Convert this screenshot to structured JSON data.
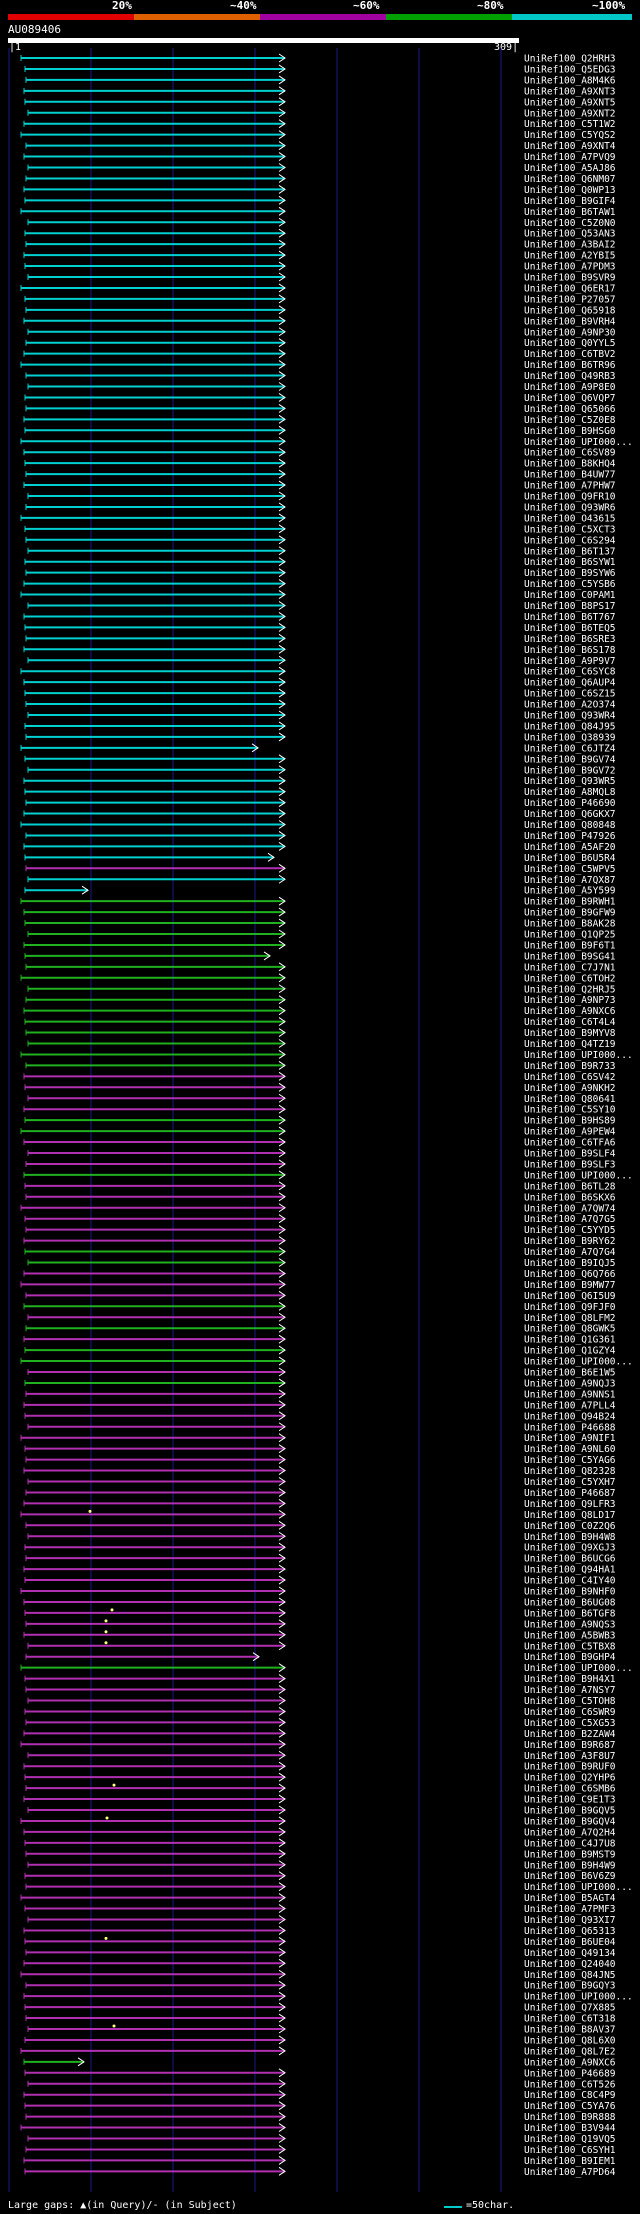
{
  "legend": {
    "labels": [
      "20%",
      "~40%",
      "~60%",
      "~80%",
      "~100%"
    ],
    "colors": [
      "#e00000",
      "#e06000",
      "#a000a0",
      "#00a000",
      "#00c8c8"
    ]
  },
  "query": {
    "id": "AU089406",
    "start": "1",
    "end": "309"
  },
  "colors": {
    "cyan": "#00d0d0",
    "green": "#20b020",
    "magenta": "#b030b0",
    "arrow_line": "#ffffff",
    "gap_marker": "#ffff80",
    "grid": "#1a1a8a"
  },
  "hits": [
    "UniRef100_Q2HRH3",
    "UniRef100_Q5EDG3",
    "UniRef100_A8M4K6",
    "UniRef100_A9XNT3",
    "UniRef100_A9XNT5",
    "UniRef100_A9XNT2",
    "UniRef100_C5T1W2",
    "UniRef100_C5YQS2",
    "UniRef100_A9XNT4",
    "UniRef100_A7PVQ9",
    "UniRef100_A5AJ86",
    "UniRef100_Q6NM07",
    "UniRef100_Q0WP13",
    "UniRef100_B9GIF4",
    "UniRef100_B6TAW1",
    "UniRef100_C5Z0N0",
    "UniRef100_Q53AN3",
    "UniRef100_A3BAI2",
    "UniRef100_A2YBI5",
    "UniRef100_A7PDM3",
    "UniRef100_B9SVR9",
    "UniRef100_Q6ER17",
    "UniRef100_P27057",
    "UniRef100_Q65918",
    "UniRef100_B9VRH4",
    "UniRef100_A9NP30",
    "UniRef100_Q0YYL5",
    "UniRef100_C6TBV2",
    "UniRef100_B6TR96",
    "UniRef100_Q49RB3",
    "UniRef100_A9P8E0",
    "UniRef100_Q6VQP7",
    "UniRef100_Q65066",
    "UniRef100_C5Z0E8",
    "UniRef100_B9HSG0",
    "UniRef100_UPI000...",
    "UniRef100_C6SV89",
    "UniRef100_B8KHQ4",
    "UniRef100_B4UW77",
    "UniRef100_A7PHW7",
    "UniRef100_Q9FR10",
    "UniRef100_Q93WR6",
    "UniRef100_O43615",
    "UniRef100_C5XCT3",
    "UniRef100_C6S294",
    "UniRef100_B6T137",
    "UniRef100_B6SYW1",
    "UniRef100_B9SYW6",
    "UniRef100_C5YSB6",
    "UniRef100_C0PAM1",
    "UniRef100_B8PS17",
    "UniRef100_B6T767",
    "UniRef100_B6TEQ5",
    "UniRef100_B6SRE3",
    "UniRef100_B6S178",
    "UniRef100_A9P9V7",
    "UniRef100_C6SYC8",
    "UniRef100_Q6AUP4",
    "UniRef100_C6SZ15",
    "UniRef100_A2O374",
    "UniRef100_Q93WR4",
    "UniRef100_Q84J95",
    "UniRef100_Q38939",
    "UniRef100_C6JTZ4",
    "UniRef100_B9GV74",
    "UniRef100_B9GV72",
    "UniRef100_Q93WR5",
    "UniRef100_A8MQL8",
    "UniRef100_P46690",
    "UniRef100_Q6GKX7",
    "UniRef100_Q80848",
    "UniRef100_P47926",
    "UniRef100_A5AF20",
    "UniRef100_B6U5R4",
    "UniRef100_C5WPV5",
    "UniRef100_A7QX87",
    "UniRef100_A5Y599",
    "UniRef100_B9RWH1",
    "UniRef100_B9GFW9",
    "UniRef100_B8AK28",
    "UniRef100_Q1QP25",
    "UniRef100_B9F6T1",
    "UniRef100_B9SG41",
    "UniRef100_C7J7N1",
    "UniRef100_C6TOH2",
    "UniRef100_Q2HRJ5",
    "UniRef100_A9NP73",
    "UniRef100_A9NXC6",
    "UniRef100_C6T4L4",
    "UniRef100_B9MYV8",
    "UniRef100_Q4TZ19",
    "UniRef100_UPI000...",
    "UniRef100_B9R733",
    "UniRef100_C6SV42",
    "UniRef100_A9NKH2",
    "UniRef100_Q80641",
    "UniRef100_C5SY10",
    "UniRef100_B9HS89",
    "UniRef100_A9PEW4",
    "UniRef100_C6TFA6",
    "UniRef100_B9SLF4",
    "UniRef100_B9SLF3",
    "UniRef100_UPI000...",
    "UniRef100_B6TL28",
    "UniRef100_B6SKX6",
    "UniRef100_A7QW74",
    "UniRef100_A7Q7G5",
    "UniRef100_C5YYD5",
    "UniRef100_B9RY62",
    "UniRef100_A7Q7G4",
    "UniRef100_B9IQJ5",
    "UniRef100_Q6Q766",
    "UniRef100_B9MW77",
    "UniRef100_Q6I5U9",
    "UniRef100_Q9FJF0",
    "UniRef100_Q8LFM2",
    "UniRef100_Q8GWK5",
    "UniRef100_Q1G361",
    "UniRef100_Q1GZY4",
    "UniRef100_UPI000...",
    "UniRef100_B6E1W5",
    "UniRef100_A9NQJ3",
    "UniRef100_A9NNS1",
    "UniRef100_A7PLL4",
    "UniRef100_Q94B24",
    "UniRef100_P46688",
    "UniRef100_A9NIF1",
    "UniRef100_A9NL60",
    "UniRef100_C5YAG6",
    "UniRef100_Q82328",
    "UniRef100_C5YXH7",
    "UniRef100_P46687",
    "UniRef100_Q9LFR3",
    "UniRef100_Q8LD17",
    "UniRef100_C0Z2Q6",
    "UniRef100_B9H4W8",
    "UniRef100_Q9XGJ3",
    "UniRef100_B6UCG6",
    "UniRef100_Q94HA1",
    "UniRef100_C4IY40",
    "UniRef100_B9NHF0",
    "UniRef100_B6UG08",
    "UniRef100_B6TGF8",
    "UniRef100_A9NQS3",
    "UniRef100_A5BWB3",
    "UniRef100_C5TBX8",
    "UniRef100_B9GHP4",
    "UniRef100_UPI000...",
    "UniRef100_B9H4X1",
    "UniRef100_A7NSY7",
    "UniRef100_C5TOH8",
    "UniRef100_C6SWR9",
    "UniRef100_C5XG53",
    "UniRef100_B2ZAW4",
    "UniRef100_B9R687",
    "UniRef100_A3F8U7",
    "UniRef100_B9RUF0",
    "UniRef100_Q2YHP6",
    "UniRef100_C6SMB6",
    "UniRef100_C9E1T3",
    "UniRef100_B9GQV5",
    "UniRef100_B9GQV4",
    "UniRef100_A7Q2H4",
    "UniRef100_C4J7U8",
    "UniRef100_B9MST9",
    "UniRef100_B9H4W9",
    "UniRef100_B6V6Z9",
    "UniRef100_UPI000...",
    "UniRef100_B5AGT4",
    "UniRef100_A7PMF3",
    "UniRef100_Q93XI7",
    "UniRef100_Q65313",
    "UniRef100_B6UE04",
    "UniRef100_Q49134",
    "UniRef100_Q24040",
    "UniRef100_Q84JN5",
    "UniRef100_B9GQY3",
    "UniRef100_UPI000...",
    "UniRef100_Q7X885",
    "UniRef100_C6T318",
    "UniRef100_B8AV37",
    "UniRef100_Q8L6X0",
    "UniRef100_Q8L7E2",
    "UniRef100_A9NXC6",
    "UniRef100_P46689",
    "UniRef100_C6T526",
    "UniRef100_C8C4P9",
    "UniRef100_C5YA76",
    "UniRef100_B9R888",
    "UniRef100_B3V944",
    "UniRef100_Q19VQ5",
    "UniRef100_C6SYH1",
    "UniRef100_B9IEM1",
    "UniRef100_A7PD64"
  ],
  "footer": {
    "gaps": "Large gaps: ▲(in Query)/- (in Subject)",
    "key": "=50char."
  }
}
